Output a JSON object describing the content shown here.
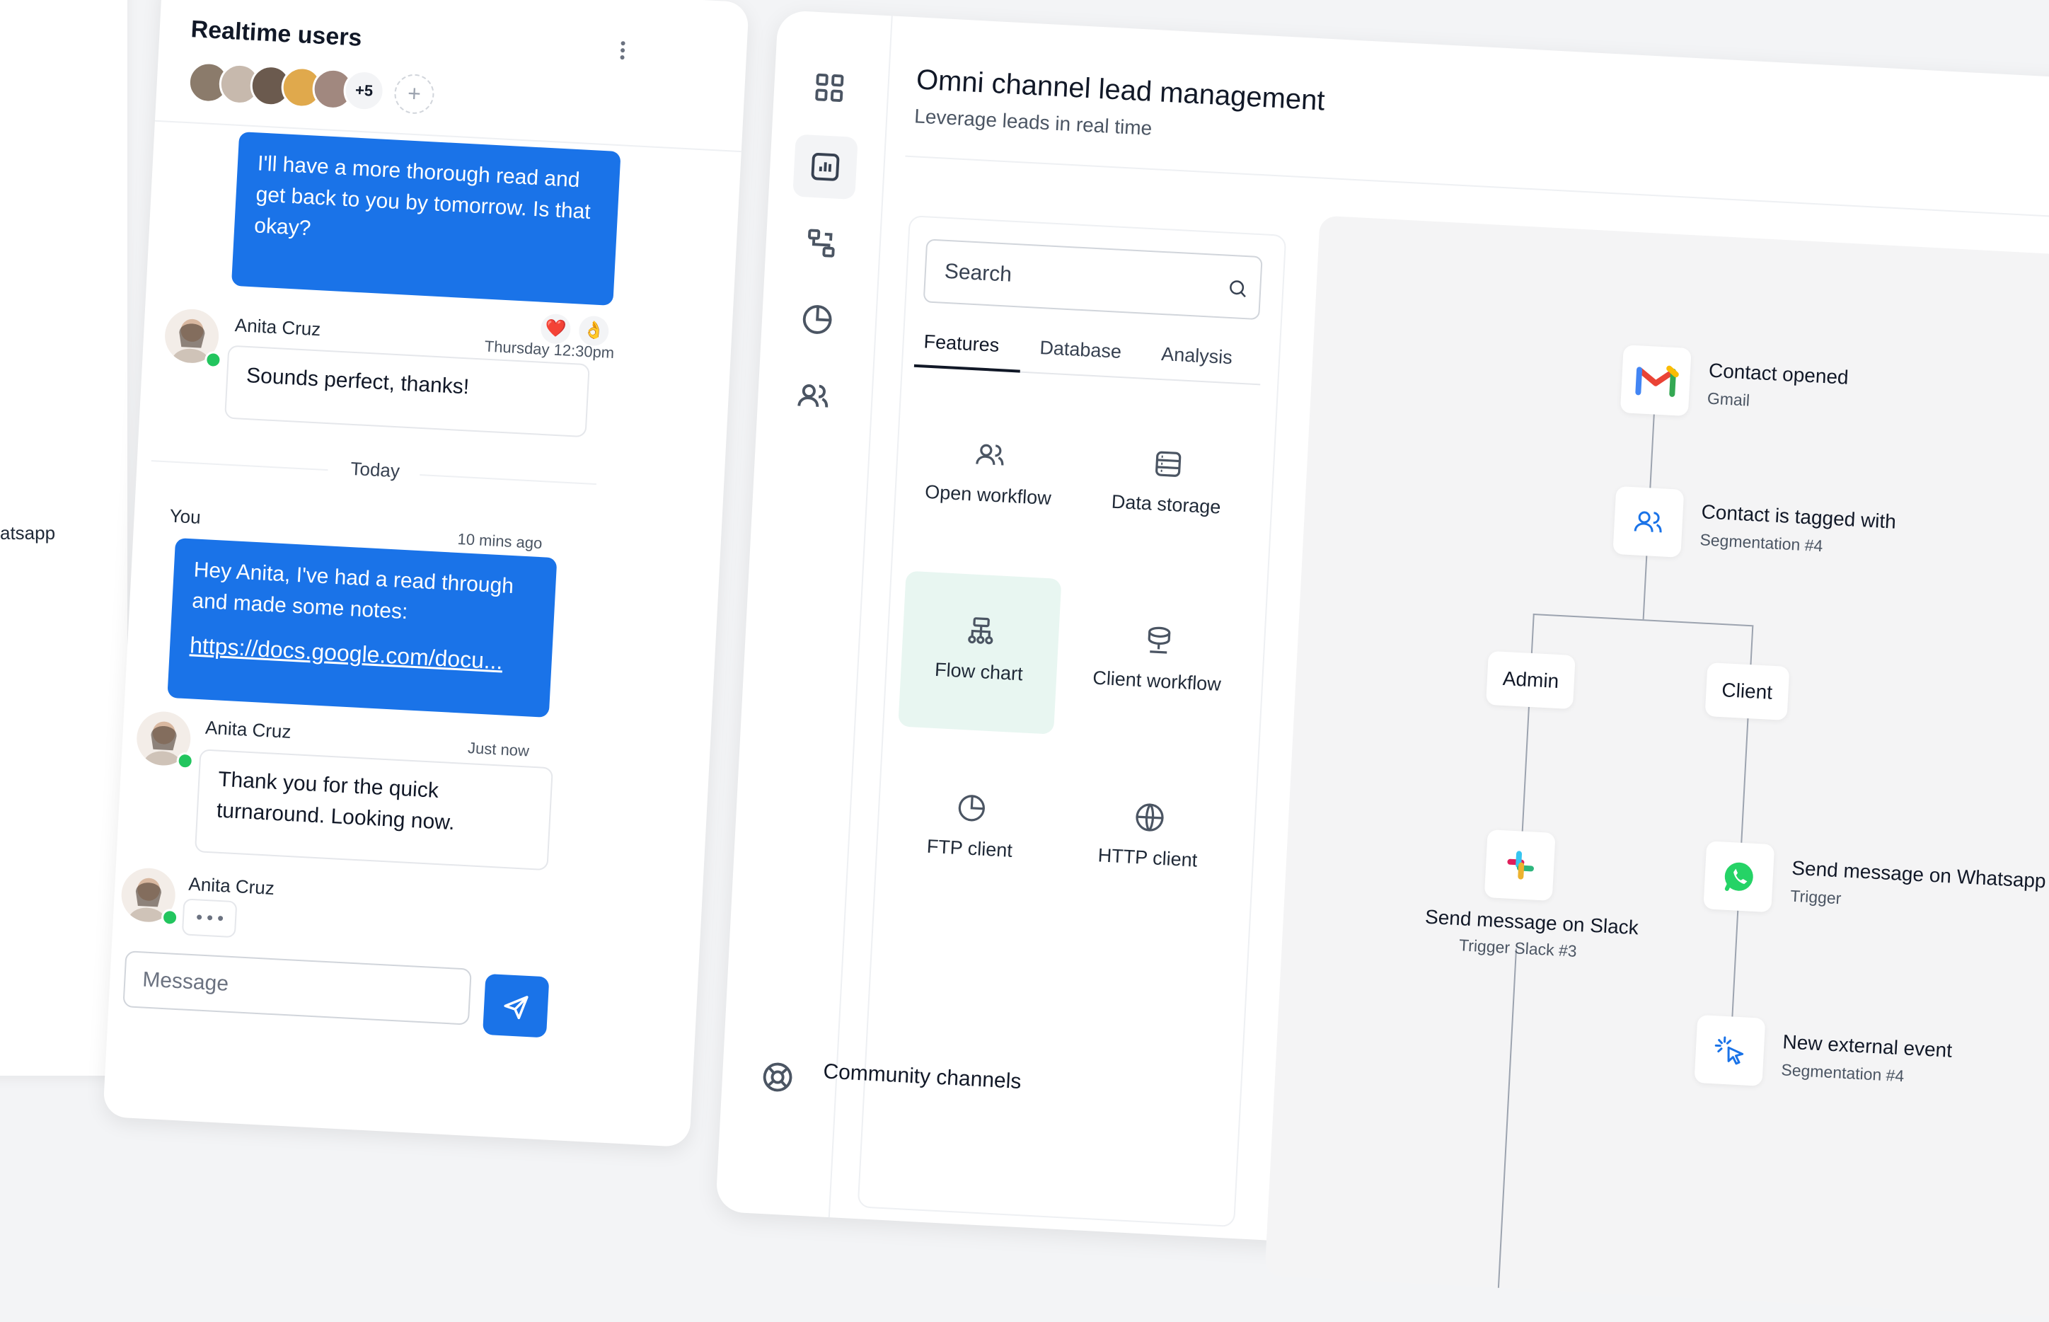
{
  "left_panel": {
    "whatsapp_label": "atsapp"
  },
  "chat": {
    "title": "Realtime users",
    "more_count": "+5",
    "add_symbol": "+",
    "messages": {
      "m1": "I'll have a more thorough read and get back to you by tomorrow. Is that okay?",
      "m2_name": "Anita Cruz",
      "m2_time": "Thursday 12:30pm",
      "m2_text": "Sounds perfect, thanks!",
      "divider": "Today",
      "m3_name": "You",
      "m3_time": "10 mins ago",
      "m3_text": "Hey Anita, I've had a read through and made some notes:",
      "m3_link": "https://docs.google.com/docu...",
      "m4_name": "Anita Cruz",
      "m4_time": "Just now",
      "m4_text": "Thank you for the quick turnaround. Looking now.",
      "m5_name": "Anita Cruz"
    },
    "reactions": [
      "❤️",
      "👌"
    ],
    "input_placeholder": "Message"
  },
  "main": {
    "title": "Omni channel lead management",
    "subtitle": "Leverage leads in real time",
    "search_placeholder": "Search",
    "tabs": [
      "Features",
      "Database",
      "Analysis"
    ],
    "tiles": [
      {
        "label": "Open workflow",
        "icon": "users-icon"
      },
      {
        "label": "Data storage",
        "icon": "database-icon"
      },
      {
        "label": "Flow chart",
        "icon": "flowchart-icon"
      },
      {
        "label": "Client workflow",
        "icon": "server-icon"
      },
      {
        "label": "FTP client",
        "icon": "pie-icon"
      },
      {
        "label": "HTTP client",
        "icon": "globe-icon"
      }
    ],
    "community_title": "Community channels"
  },
  "flow": {
    "contact_opened": {
      "title": "Contact opened",
      "sub": "Gmail"
    },
    "tagged": {
      "title": "Contact is tagged with",
      "sub": "Segmentation #4"
    },
    "admin": "Admin",
    "client": "Client",
    "slack": {
      "title": "Send message on Slack",
      "sub": "Trigger Slack #3"
    },
    "whatsapp": {
      "title": "Send message on Whatsapp",
      "sub": "Trigger"
    },
    "external": {
      "title": "New external event",
      "sub": "Segmentation #4"
    }
  },
  "colors": {
    "accent": "#1a73e8",
    "online": "#22c55e",
    "active_tile": "#e8f6f1"
  }
}
